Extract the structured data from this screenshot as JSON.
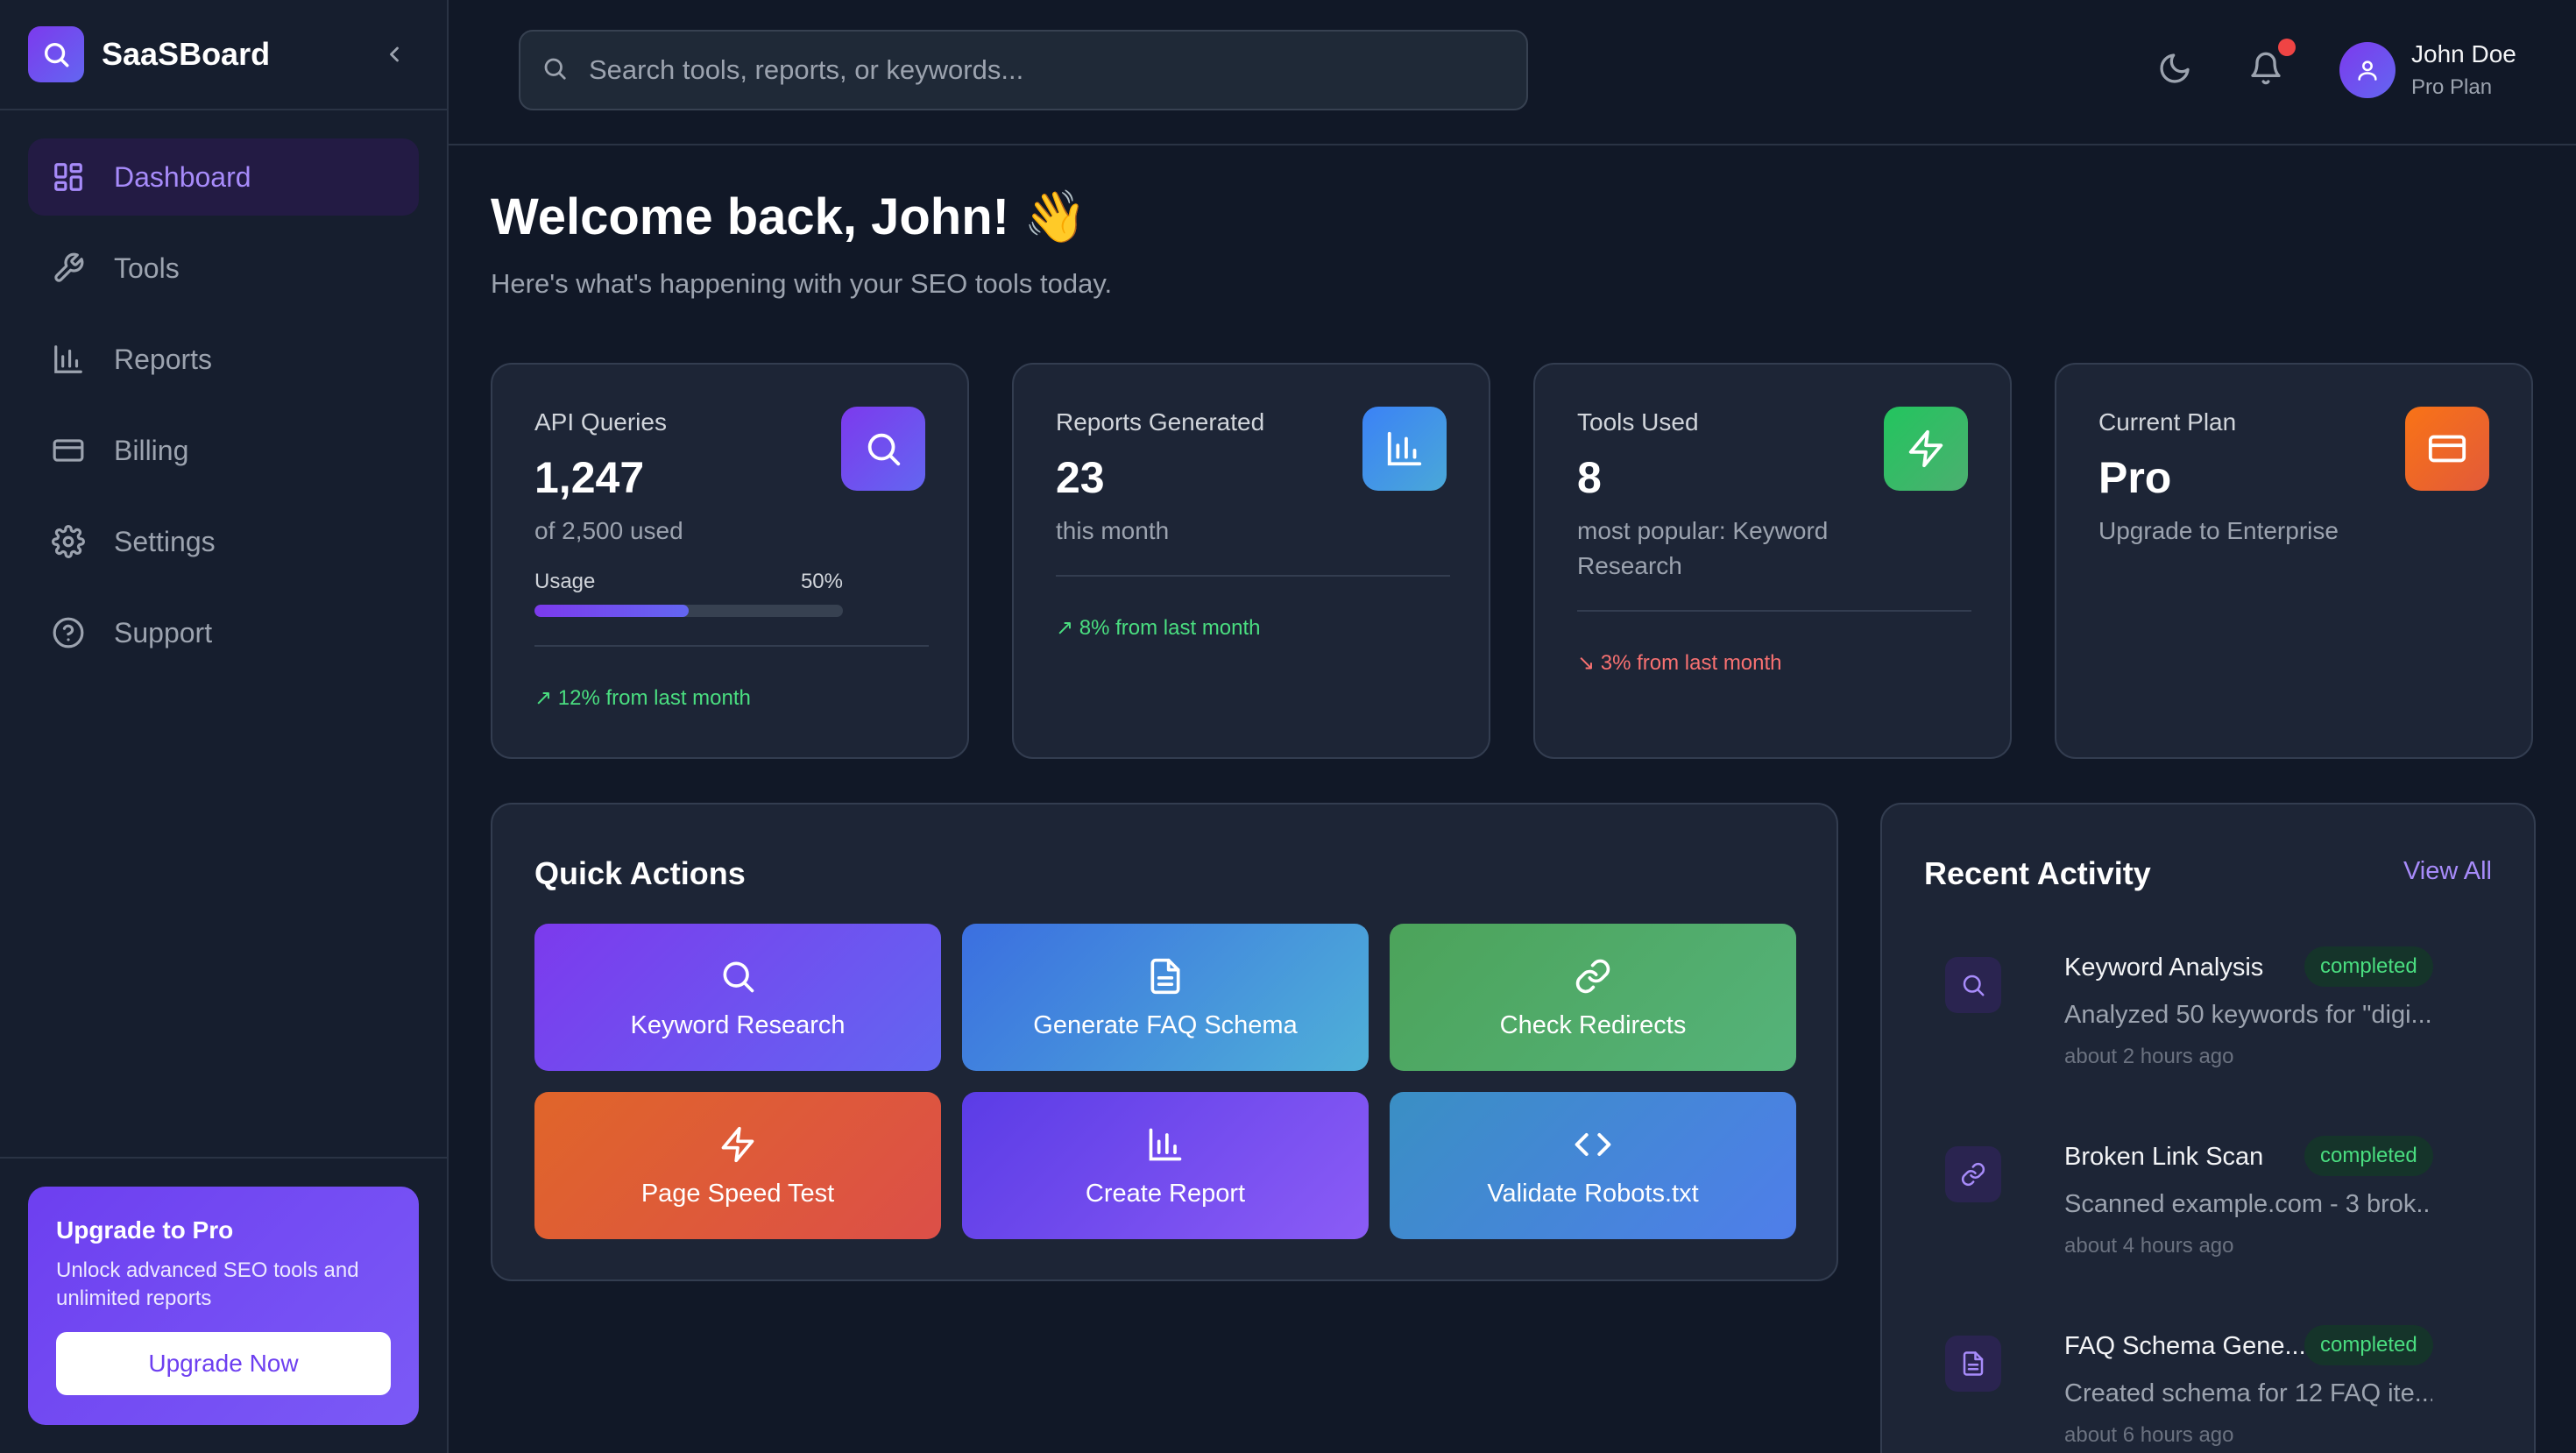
{
  "brand": {
    "name": "SaaSBoard"
  },
  "nav": {
    "items": [
      {
        "label": "Dashboard",
        "icon": "grid-icon",
        "active": true
      },
      {
        "label": "Tools",
        "icon": "wrench-icon",
        "active": false
      },
      {
        "label": "Reports",
        "icon": "bar-chart-icon",
        "active": false
      },
      {
        "label": "Billing",
        "icon": "credit-card-icon",
        "active": false
      },
      {
        "label": "Settings",
        "icon": "gear-icon",
        "active": false
      },
      {
        "label": "Support",
        "icon": "help-circle-icon",
        "active": false
      }
    ]
  },
  "upgrade": {
    "title": "Upgrade to Pro",
    "description": "Unlock advanced SEO tools and unlimited reports",
    "button": "Upgrade Now"
  },
  "search": {
    "placeholder": "Search tools, reports, or keywords..."
  },
  "user": {
    "name": "John Doe",
    "plan": "Pro Plan"
  },
  "header": {
    "welcome": "Welcome back, John! 👋",
    "subtitle": "Here's what's happening with your SEO tools today."
  },
  "stats": [
    {
      "label": "API Queries",
      "value": "1,247",
      "sub": "of 2,500 used",
      "usage_label": "Usage",
      "usage_percent_text": "50%",
      "usage_fraction": 0.5,
      "trend": "↗ 12% from last month",
      "trend_dir": "up",
      "icon": "search-icon",
      "color": "#7c3aed"
    },
    {
      "label": "Reports Generated",
      "value": "23",
      "sub": "this month",
      "trend": "↗ 8% from last month",
      "trend_dir": "up",
      "icon": "bar-chart-icon",
      "color": "#3b82f6"
    },
    {
      "label": "Tools Used",
      "value": "8",
      "sub": "most popular: Keyword Research",
      "trend": "↘ 3% from last month",
      "trend_dir": "down",
      "icon": "lightning-icon",
      "color": "#22c55e"
    },
    {
      "label": "Current Plan",
      "value": "Pro",
      "sub": "Upgrade to Enterprise",
      "icon": "credit-card-icon",
      "color": "#f97316"
    }
  ],
  "quick_actions": {
    "title": "Quick Actions",
    "items": [
      {
        "label": "Keyword Research",
        "icon": "search-icon"
      },
      {
        "label": "Generate FAQ Schema",
        "icon": "document-icon"
      },
      {
        "label": "Check Redirects",
        "icon": "link-icon"
      },
      {
        "label": "Page Speed Test",
        "icon": "lightning-icon"
      },
      {
        "label": "Create Report",
        "icon": "bar-chart-icon"
      },
      {
        "label": "Validate Robots.txt",
        "icon": "code-icon"
      }
    ]
  },
  "recent_activity": {
    "title": "Recent Activity",
    "view_all": "View All",
    "items": [
      {
        "title": "Keyword Analysis",
        "status": "completed",
        "description": "Analyzed 50 keywords for \"digi...",
        "time": "about 2 hours ago",
        "icon": "search-icon"
      },
      {
        "title": "Broken Link Scan",
        "status": "completed",
        "description": "Scanned example.com - 3 brok...",
        "time": "about 4 hours ago",
        "icon": "link-icon"
      },
      {
        "title": "FAQ Schema Gene...",
        "status": "completed",
        "description": "Created schema for 12 FAQ ite...",
        "time": "about 6 hours ago",
        "icon": "document-icon"
      }
    ]
  }
}
